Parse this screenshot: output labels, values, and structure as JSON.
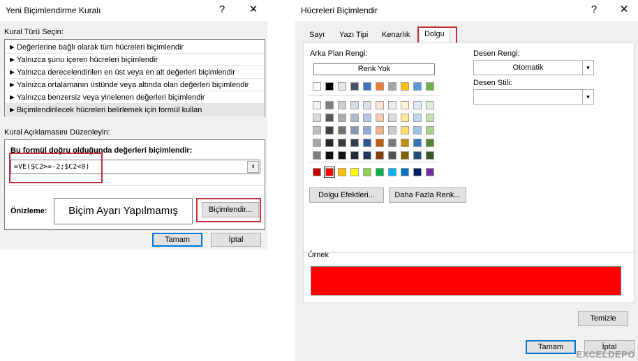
{
  "left_dialog": {
    "title": "Yeni Biçimlendirme Kuralı",
    "help": "?",
    "close": "✕",
    "rule_type_label": "Kural Türü Seçin:",
    "rule_types": [
      "Değerlerine bağlı olarak tüm hücreleri biçimlendir",
      "Yalnızca şunu içeren hücreleri biçimlendir",
      "Yalnızca derecelendirilen en üst veya en alt değerleri biçimlendir",
      "Yalnızca ortalamanın üstünde veya altında olan değerleri biçimlendir",
      "Yalnızca benzersiz veya yinelenen değerleri biçimlendir",
      "Biçimlendirilecek hücreleri belirlemek için formül kullan"
    ],
    "rule_arrow": "►",
    "edit_label": "Kural Açıklamasını Düzenleyin:",
    "formula_label": "Bu formül doğru olduğunda değerleri biçimlendir:",
    "formula_value": "=VE($C2>=-2;$C2<0)",
    "collapse_icon": "⬆",
    "preview_label": "Önizleme:",
    "preview_text": "Biçim Ayarı Yapılmamış",
    "format_button": "Biçimlendir...",
    "ok_button": "Tamam",
    "cancel_button": "İptal"
  },
  "right_dialog": {
    "title": "Hücreleri Biçimlendir",
    "help": "?",
    "close": "✕",
    "tabs": [
      "Sayı",
      "Yazı Tipi",
      "Kenarlık",
      "Dolgu"
    ],
    "active_tab": "Dolgu",
    "bg_color_label": "Arka Plan Rengi:",
    "no_color_button": "Renk Yok",
    "fill_effects_button": "Dolgu Efektleri...",
    "more_colors_button": "Daha Fazla Renk...",
    "pattern_color_label": "Desen Rengi:",
    "pattern_color_value": "Otomatik",
    "pattern_style_label": "Desen Stili:",
    "pattern_style_value": "",
    "sample_label": "Örnek",
    "sample_color": "#ff0000",
    "clear_button": "Temizle",
    "ok_button": "Tamam",
    "cancel_button": "İptal",
    "watermark": "EXCELDEPO",
    "theme_row": [
      "#ffffff",
      "#000000",
      "#e7e6e6",
      "#44546a",
      "#4472c4",
      "#ed7d31",
      "#a5a5a5",
      "#ffc000",
      "#5b9bd5",
      "#70ad47"
    ],
    "tint_rows": [
      [
        "#f2f2f2",
        "#7f7f7f",
        "#d0cece",
        "#d6dce4",
        "#d9e1f2",
        "#fce4d6",
        "#ededed",
        "#fff2cc",
        "#ddebf7",
        "#e2efda"
      ],
      [
        "#d9d9d9",
        "#595959",
        "#aeaaaa",
        "#acb9ca",
        "#b4c6e7",
        "#f8cbad",
        "#dbdbdb",
        "#ffe699",
        "#bdd7ee",
        "#c6e0b4"
      ],
      [
        "#bfbfbf",
        "#404040",
        "#757171",
        "#8497b0",
        "#8ea9db",
        "#f4b084",
        "#c9c9c9",
        "#ffd966",
        "#9bc2e6",
        "#a9d08e"
      ],
      [
        "#a6a6a6",
        "#262626",
        "#3a3838",
        "#333f4f",
        "#2f5597",
        "#c65911",
        "#7b7b7b",
        "#bf8f00",
        "#2f75b5",
        "#548235"
      ],
      [
        "#808080",
        "#0d0d0d",
        "#161616",
        "#222b35",
        "#203764",
        "#833c0c",
        "#525252",
        "#806000",
        "#1f4e78",
        "#375623"
      ]
    ],
    "standard_row": [
      "#c00000",
      "#ff0000",
      "#ffc000",
      "#ffff00",
      "#92d050",
      "#00b050",
      "#00b0f0",
      "#0070c0",
      "#002060",
      "#7030a0"
    ],
    "selected_color": "#ff0000"
  }
}
